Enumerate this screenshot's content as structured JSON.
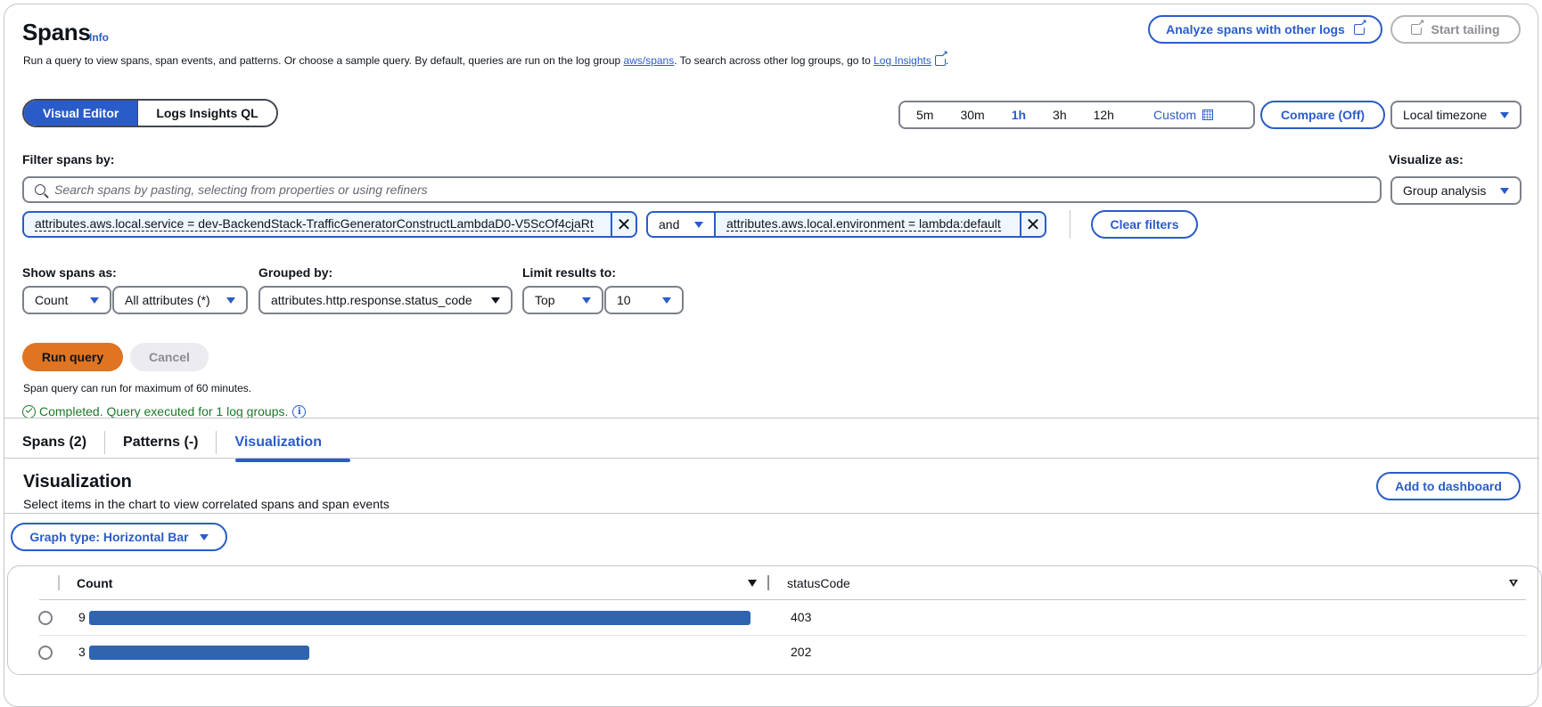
{
  "header": {
    "title": "Spans",
    "info_label": "Info",
    "description_prefix": "Run a query to view spans, span events, and patterns. Or choose a sample query. By default, queries are run on the log group ",
    "log_group_link": "aws/spans",
    "description_middle": ". To search across other log groups, go to ",
    "log_insights_link": "Log Insights",
    "description_suffix": ".",
    "analyze_button": "Analyze spans with other logs",
    "tailing_button": "Start tailing"
  },
  "editor_mode": {
    "options": [
      "Visual Editor",
      "Logs Insights QL"
    ],
    "selected": "Visual Editor"
  },
  "time_range": {
    "options": [
      "5m",
      "30m",
      "1h",
      "3h",
      "12h"
    ],
    "selected": "1h",
    "custom_label": "Custom",
    "compare_button": "Compare (Off)",
    "timezone": "Local timezone"
  },
  "filter": {
    "label": "Filter spans by:",
    "placeholder": "Search spans by pasting, selecting from properties or using refiners",
    "tokens": [
      "attributes.aws.local.service = dev-BackendStack-TrafficGeneratorConstructLambdaD0-V5ScOf4cjaRt",
      "attributes.aws.local.environment = lambda:default"
    ],
    "operator": "and",
    "clear_button": "Clear filters"
  },
  "visualize": {
    "label": "Visualize as:",
    "value": "Group analysis"
  },
  "query_options": {
    "show_spans_label": "Show spans as:",
    "show_spans_value": "Count",
    "attributes_value": "All attributes (*)",
    "grouped_by_label": "Grouped by:",
    "grouped_by_value": "attributes.http.response.status_code",
    "limit_label": "Limit results to:",
    "limit_order": "Top",
    "limit_count": "10"
  },
  "actions": {
    "run_button": "Run query",
    "cancel_button": "Cancel",
    "hint": "Span query can run for maximum of 60 minutes.",
    "status": "Completed. Query executed for 1 log groups."
  },
  "results_tabs": {
    "tabs": [
      "Spans (2)",
      "Patterns (-)",
      "Visualization"
    ],
    "active": "Visualization"
  },
  "visualization": {
    "title": "Visualization",
    "subtitle": "Select items in the chart to view correlated spans and span events",
    "add_dashboard_button": "Add to dashboard",
    "graph_type_button": "Graph type: Horizontal Bar",
    "columns": [
      "Count",
      "statusCode"
    ]
  },
  "chart_data": {
    "type": "bar",
    "orientation": "horizontal",
    "title": "",
    "xlabel": "Count",
    "ylabel": "statusCode",
    "categories": [
      "403",
      "202"
    ],
    "values": [
      9,
      3
    ],
    "sort": "Count descending"
  }
}
